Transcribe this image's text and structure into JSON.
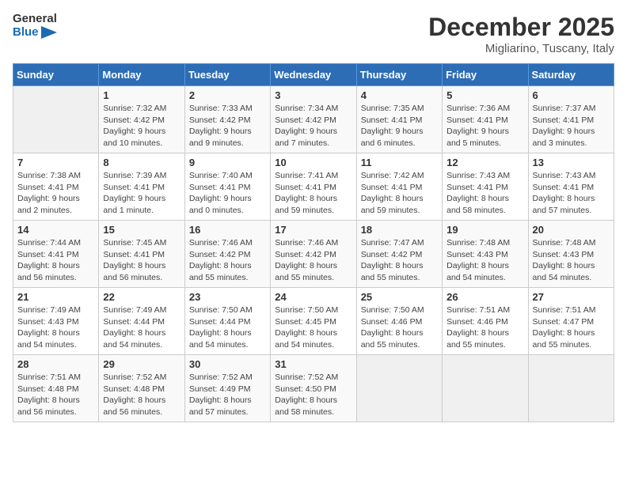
{
  "logo": {
    "line1": "General",
    "line2": "Blue"
  },
  "title": "December 2025",
  "subtitle": "Migliarino, Tuscany, Italy",
  "days_of_week": [
    "Sunday",
    "Monday",
    "Tuesday",
    "Wednesday",
    "Thursday",
    "Friday",
    "Saturday"
  ],
  "weeks": [
    [
      {
        "day": "",
        "info": ""
      },
      {
        "day": "1",
        "info": "Sunrise: 7:32 AM\nSunset: 4:42 PM\nDaylight: 9 hours\nand 10 minutes."
      },
      {
        "day": "2",
        "info": "Sunrise: 7:33 AM\nSunset: 4:42 PM\nDaylight: 9 hours\nand 9 minutes."
      },
      {
        "day": "3",
        "info": "Sunrise: 7:34 AM\nSunset: 4:42 PM\nDaylight: 9 hours\nand 7 minutes."
      },
      {
        "day": "4",
        "info": "Sunrise: 7:35 AM\nSunset: 4:41 PM\nDaylight: 9 hours\nand 6 minutes."
      },
      {
        "day": "5",
        "info": "Sunrise: 7:36 AM\nSunset: 4:41 PM\nDaylight: 9 hours\nand 5 minutes."
      },
      {
        "day": "6",
        "info": "Sunrise: 7:37 AM\nSunset: 4:41 PM\nDaylight: 9 hours\nand 3 minutes."
      }
    ],
    [
      {
        "day": "7",
        "info": "Sunrise: 7:38 AM\nSunset: 4:41 PM\nDaylight: 9 hours\nand 2 minutes."
      },
      {
        "day": "8",
        "info": "Sunrise: 7:39 AM\nSunset: 4:41 PM\nDaylight: 9 hours\nand 1 minute."
      },
      {
        "day": "9",
        "info": "Sunrise: 7:40 AM\nSunset: 4:41 PM\nDaylight: 9 hours\nand 0 minutes."
      },
      {
        "day": "10",
        "info": "Sunrise: 7:41 AM\nSunset: 4:41 PM\nDaylight: 8 hours\nand 59 minutes."
      },
      {
        "day": "11",
        "info": "Sunrise: 7:42 AM\nSunset: 4:41 PM\nDaylight: 8 hours\nand 59 minutes."
      },
      {
        "day": "12",
        "info": "Sunrise: 7:43 AM\nSunset: 4:41 PM\nDaylight: 8 hours\nand 58 minutes."
      },
      {
        "day": "13",
        "info": "Sunrise: 7:43 AM\nSunset: 4:41 PM\nDaylight: 8 hours\nand 57 minutes."
      }
    ],
    [
      {
        "day": "14",
        "info": "Sunrise: 7:44 AM\nSunset: 4:41 PM\nDaylight: 8 hours\nand 56 minutes."
      },
      {
        "day": "15",
        "info": "Sunrise: 7:45 AM\nSunset: 4:41 PM\nDaylight: 8 hours\nand 56 minutes."
      },
      {
        "day": "16",
        "info": "Sunrise: 7:46 AM\nSunset: 4:42 PM\nDaylight: 8 hours\nand 55 minutes."
      },
      {
        "day": "17",
        "info": "Sunrise: 7:46 AM\nSunset: 4:42 PM\nDaylight: 8 hours\nand 55 minutes."
      },
      {
        "day": "18",
        "info": "Sunrise: 7:47 AM\nSunset: 4:42 PM\nDaylight: 8 hours\nand 55 minutes."
      },
      {
        "day": "19",
        "info": "Sunrise: 7:48 AM\nSunset: 4:43 PM\nDaylight: 8 hours\nand 54 minutes."
      },
      {
        "day": "20",
        "info": "Sunrise: 7:48 AM\nSunset: 4:43 PM\nDaylight: 8 hours\nand 54 minutes."
      }
    ],
    [
      {
        "day": "21",
        "info": "Sunrise: 7:49 AM\nSunset: 4:43 PM\nDaylight: 8 hours\nand 54 minutes."
      },
      {
        "day": "22",
        "info": "Sunrise: 7:49 AM\nSunset: 4:44 PM\nDaylight: 8 hours\nand 54 minutes."
      },
      {
        "day": "23",
        "info": "Sunrise: 7:50 AM\nSunset: 4:44 PM\nDaylight: 8 hours\nand 54 minutes."
      },
      {
        "day": "24",
        "info": "Sunrise: 7:50 AM\nSunset: 4:45 PM\nDaylight: 8 hours\nand 54 minutes."
      },
      {
        "day": "25",
        "info": "Sunrise: 7:50 AM\nSunset: 4:46 PM\nDaylight: 8 hours\nand 55 minutes."
      },
      {
        "day": "26",
        "info": "Sunrise: 7:51 AM\nSunset: 4:46 PM\nDaylight: 8 hours\nand 55 minutes."
      },
      {
        "day": "27",
        "info": "Sunrise: 7:51 AM\nSunset: 4:47 PM\nDaylight: 8 hours\nand 55 minutes."
      }
    ],
    [
      {
        "day": "28",
        "info": "Sunrise: 7:51 AM\nSunset: 4:48 PM\nDaylight: 8 hours\nand 56 minutes."
      },
      {
        "day": "29",
        "info": "Sunrise: 7:52 AM\nSunset: 4:48 PM\nDaylight: 8 hours\nand 56 minutes."
      },
      {
        "day": "30",
        "info": "Sunrise: 7:52 AM\nSunset: 4:49 PM\nDaylight: 8 hours\nand 57 minutes."
      },
      {
        "day": "31",
        "info": "Sunrise: 7:52 AM\nSunset: 4:50 PM\nDaylight: 8 hours\nand 58 minutes."
      },
      {
        "day": "",
        "info": ""
      },
      {
        "day": "",
        "info": ""
      },
      {
        "day": "",
        "info": ""
      }
    ]
  ]
}
